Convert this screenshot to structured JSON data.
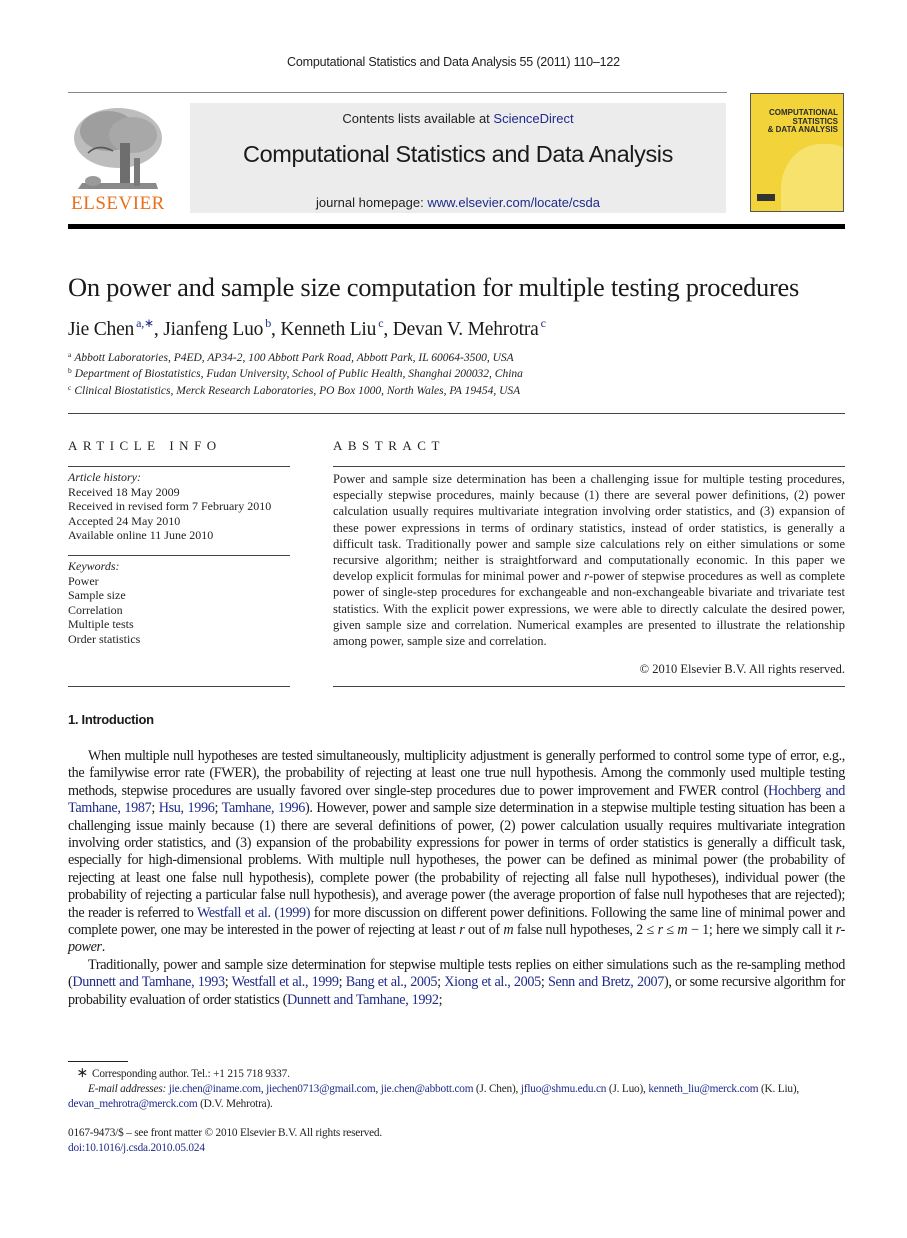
{
  "running_head": "Computational Statistics and Data Analysis 55 (2011) 110–122",
  "publisher": {
    "name": "ELSEVIER",
    "logo_color": "#e8701a"
  },
  "banner": {
    "contents_prefix": "Contents lists available at ",
    "contents_link": "ScienceDirect",
    "journal_title": "Computational Statistics and Data Analysis",
    "homepage_prefix": "journal homepage: ",
    "homepage_link": "www.elsevier.com/locate/csda"
  },
  "cover": {
    "line1": "COMPUTATIONAL",
    "line2": "STATISTICS",
    "line3": "& DATA ANALYSIS",
    "color": "#f2d43a"
  },
  "article": {
    "title": "On power and sample size computation for multiple testing procedures",
    "authors": [
      {
        "name": "Jie Chen",
        "sup": "a,∗",
        "sep": ", "
      },
      {
        "name": "Jianfeng Luo",
        "sup": "b",
        "sep": ", "
      },
      {
        "name": "Kenneth Liu",
        "sup": "c",
        "sep": ", "
      },
      {
        "name": "Devan V. Mehrotra",
        "sup": "c",
        "sep": ""
      }
    ],
    "affiliations": [
      {
        "mark": "a",
        "text": "Abbott Laboratories, P4ED, AP34-2, 100 Abbott Park Road, Abbott Park, IL 60064-3500, USA"
      },
      {
        "mark": "b",
        "text": "Department of Biostatistics, Fudan University, School of Public Health, Shanghai 200032, China"
      },
      {
        "mark": "c",
        "text": "Clinical Biostatistics, Merck Research Laboratories, PO Box 1000, North Wales, PA 19454, USA"
      }
    ]
  },
  "article_info": {
    "heading": "ARTICLE INFO",
    "history_label": "Article history:",
    "history": [
      "Received 18 May 2009",
      "Received in revised form 7 February 2010",
      "Accepted 24 May 2010",
      "Available online 11 June 2010"
    ],
    "keywords_label": "Keywords:",
    "keywords": [
      "Power",
      "Sample size",
      "Correlation",
      "Multiple tests",
      "Order statistics"
    ]
  },
  "abstract": {
    "heading": "ABSTRACT",
    "text_part1": "Power and sample size determination has been a challenging issue for multiple testing procedures, especially stepwise procedures, mainly because (1) there are several power definitions, (2) power calculation usually requires multivariate integration involving order statistics, and (3) expansion of these power expressions in terms of ordinary statistics, instead of order statistics, is generally a difficult task. Traditionally power and sample size calculations rely on either simulations or some recursive algorithm; neither is straightforward and computationally economic. In this paper we develop explicit formulas for minimal power and ",
    "text_italic": "r",
    "text_part2": "-power of stepwise procedures as well as complete power of single-step procedures for exchangeable and non-exchangeable bivariate and trivariate test statistics. With the explicit power expressions, we were able to directly calculate the desired power, given sample size and correlation. Numerical examples are presented to illustrate the relationship among power, sample size and correlation.",
    "copyright": "© 2010 Elsevier B.V. All rights reserved."
  },
  "introduction": {
    "heading": "1.  Introduction",
    "p1": {
      "a": "When multiple null hypotheses are tested simultaneously, multiplicity adjustment is generally performed to control some type of error, e.g., the familywise error rate (FWER), the probability of rejecting at least one true null hypothesis. Among the commonly used multiple testing methods, stepwise procedures are usually favored over single-step procedures due to power improvement and FWER control (",
      "cite1": "Hochberg and Tamhane, 1987",
      "sep1": "; ",
      "cite2": "Hsu, 1996",
      "sep2": "; ",
      "cite3": "Tamhane, 1996",
      "b": "). However, power and sample size determination in a stepwise multiple testing situation has been a challenging issue mainly because (1) there are several definitions of power, (2) power calculation usually requires multivariate integration involving order statistics, and (3) expansion of the probability expressions for power in terms of order statistics is generally a difficult task, especially for high-dimensional problems. With multiple null hypotheses, the power can be defined as minimal power (the probability of rejecting at least one false null hypothesis), complete power (the probability of rejecting all false null hypotheses), individual power (the probability of rejecting a particular false null hypothesis), and average power (the average proportion of false null hypotheses that are rejected); the reader is referred to ",
      "cite4": "Westfall et al. (1999)",
      "c": " for more discussion on different power definitions. Following the same line of minimal power and complete power, one may be interested in the power of rejecting at least ",
      "r": "r",
      "d": " out of ",
      "m": "m",
      "e": " false null hypotheses, 2 ≤ ",
      "r2": "r",
      "f": " ≤ ",
      "m2": "m",
      "g": " − 1; here we simply call it ",
      "rpower": "r-power",
      "h": "."
    },
    "p2": {
      "a": "Traditionally, power and sample size determination for stepwise multiple tests replies on either simulations such as the re-sampling method (",
      "cite1": "Dunnett and Tamhane, 1993",
      "cite2": "Westfall et al., 1999",
      "cite3": "Bang et al., 2005",
      "cite4": "Xiong et al., 2005",
      "cite5": "Senn and Bretz, 2007",
      "b": "), or some recursive algorithm for probability evaluation of order statistics (",
      "cite6": "Dunnett and Tamhane, 1992",
      "c": ";",
      "sep": "; "
    }
  },
  "footnotes": {
    "star": "∗",
    "corresponding": "Corresponding author. Tel.: +1 215 718 9337.",
    "email_label": "E-mail addresses:",
    "emails": [
      {
        "addr": "jie.chen@iname.com",
        "after": ", "
      },
      {
        "addr": "jiechen0713@gmail.com",
        "after": ", "
      },
      {
        "addr": "jie.chen@abbott.com",
        "after": " (J. Chen), "
      },
      {
        "addr": "jfluo@shmu.edu.cn",
        "after": " (J. Luo), "
      },
      {
        "addr": "kenneth_liu@merck.com",
        "after": " (K. Liu), "
      },
      {
        "addr": "devan_mehrotra@merck.com",
        "after": " (D.V. Mehrotra)."
      }
    ]
  },
  "front_matter": {
    "issn_line": "0167-9473/$ – see front matter © 2010 Elsevier B.V. All rights reserved.",
    "doi": "doi:10.1016/j.csda.2010.05.024"
  }
}
